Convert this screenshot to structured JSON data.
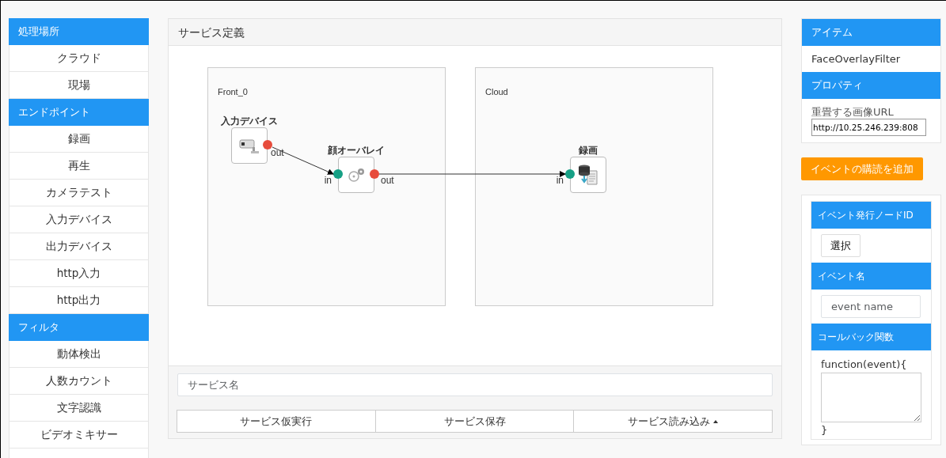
{
  "sidebar": {
    "sections": [
      {
        "title": "処理場所",
        "items": [
          {
            "label": "クラウド"
          },
          {
            "label": "現場"
          }
        ]
      },
      {
        "title": "エンドポイント",
        "items": [
          {
            "label": "録画"
          },
          {
            "label": "再生"
          },
          {
            "label": "カメラテスト"
          },
          {
            "label": "入力デバイス"
          },
          {
            "label": "出力デバイス"
          },
          {
            "label": "http入力"
          },
          {
            "label": "http出力"
          }
        ]
      },
      {
        "title": "フィルタ",
        "items": [
          {
            "label": "動体検出"
          },
          {
            "label": "人数カウント"
          },
          {
            "label": "文字認識"
          },
          {
            "label": "ビデオミキサー"
          }
        ]
      }
    ]
  },
  "service": {
    "title": "サービス定義",
    "regions": [
      {
        "label": "Front_0"
      },
      {
        "label": "Cloud"
      }
    ],
    "nodes": [
      {
        "title": "入力デバイス",
        "kind": "camera",
        "ports": [
          {
            "kind": "out",
            "label": "out"
          }
        ]
      },
      {
        "title": "顔オーバレイ",
        "kind": "filter",
        "ports": [
          {
            "kind": "in",
            "label": "in"
          },
          {
            "kind": "out",
            "label": "out"
          }
        ]
      },
      {
        "title": "録画",
        "kind": "recorder",
        "ports": [
          {
            "kind": "in",
            "label": "in"
          }
        ]
      }
    ],
    "connections": [
      {
        "kind": "arrow"
      },
      {
        "kind": "arrow"
      }
    ],
    "name_field": {
      "placeholder": "サービス名"
    },
    "buttons": [
      {
        "label": "サービス仮実行",
        "dropup": false
      },
      {
        "label": "サービス保存",
        "dropup": false
      },
      {
        "label": "サービス読み込み",
        "dropup": true
      }
    ]
  },
  "inspector": {
    "item_header": "アイテム",
    "item": "FaceOverlayFilter",
    "property_header": "プロパティ",
    "property_label": "重畳する画像URL",
    "property_value": "http://10.25.246.239:808",
    "add_button": "イベントの購読を追加",
    "subscription": {
      "node_header": "イベント発行ノードID",
      "select_button": "選択",
      "event_header": "イベント名",
      "event_placeholder": "event name",
      "callback_header": "コールバック関数",
      "callback_open": "function(event){",
      "callback_close": "}"
    }
  }
}
